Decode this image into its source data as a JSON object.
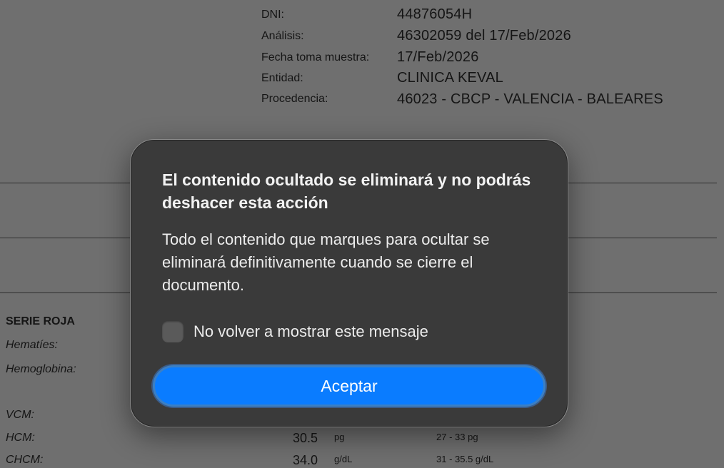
{
  "document": {
    "header": [
      {
        "label": "DNI:",
        "value": "44876054H"
      },
      {
        "label": "Análisis:",
        "value": "46302059 del 17/Feb/2026"
      },
      {
        "label": "Fecha toma muestra:",
        "value": "17/Feb/2026"
      },
      {
        "label": "Entidad:",
        "value": "CLINICA KEVAL"
      },
      {
        "label": "Procedencia:",
        "value": "46023 - CBCP - VALENCIA - BALEARES"
      }
    ],
    "section_title": "SERIE ROJA",
    "rows": [
      {
        "label": "Hematíes:",
        "value": "",
        "unit": "",
        "range": ""
      },
      {
        "label": "Hemoglobina:",
        "value": "",
        "unit": "",
        "range": ""
      },
      {
        "label": "VCM:",
        "value": "",
        "unit": "",
        "range": ""
      },
      {
        "label": "HCM:",
        "value": "30.5",
        "unit": "pg",
        "range": "27 - 33 pg"
      },
      {
        "label": "CHCM:",
        "value": "34.0",
        "unit": "g/dL",
        "range": "31 - 35.5 g/dL"
      }
    ]
  },
  "dialog": {
    "title": "El contenido ocultado se eliminará y no podrás deshacer esta acción",
    "body": "Todo el contenido que marques para ocultar se eliminará definitivamente cuando se cierre el documento.",
    "checkbox_label": "No volver a mostrar este mensaje",
    "checkbox_checked": false,
    "accept_label": "Aceptar",
    "accent_color": "#0a7cff"
  }
}
